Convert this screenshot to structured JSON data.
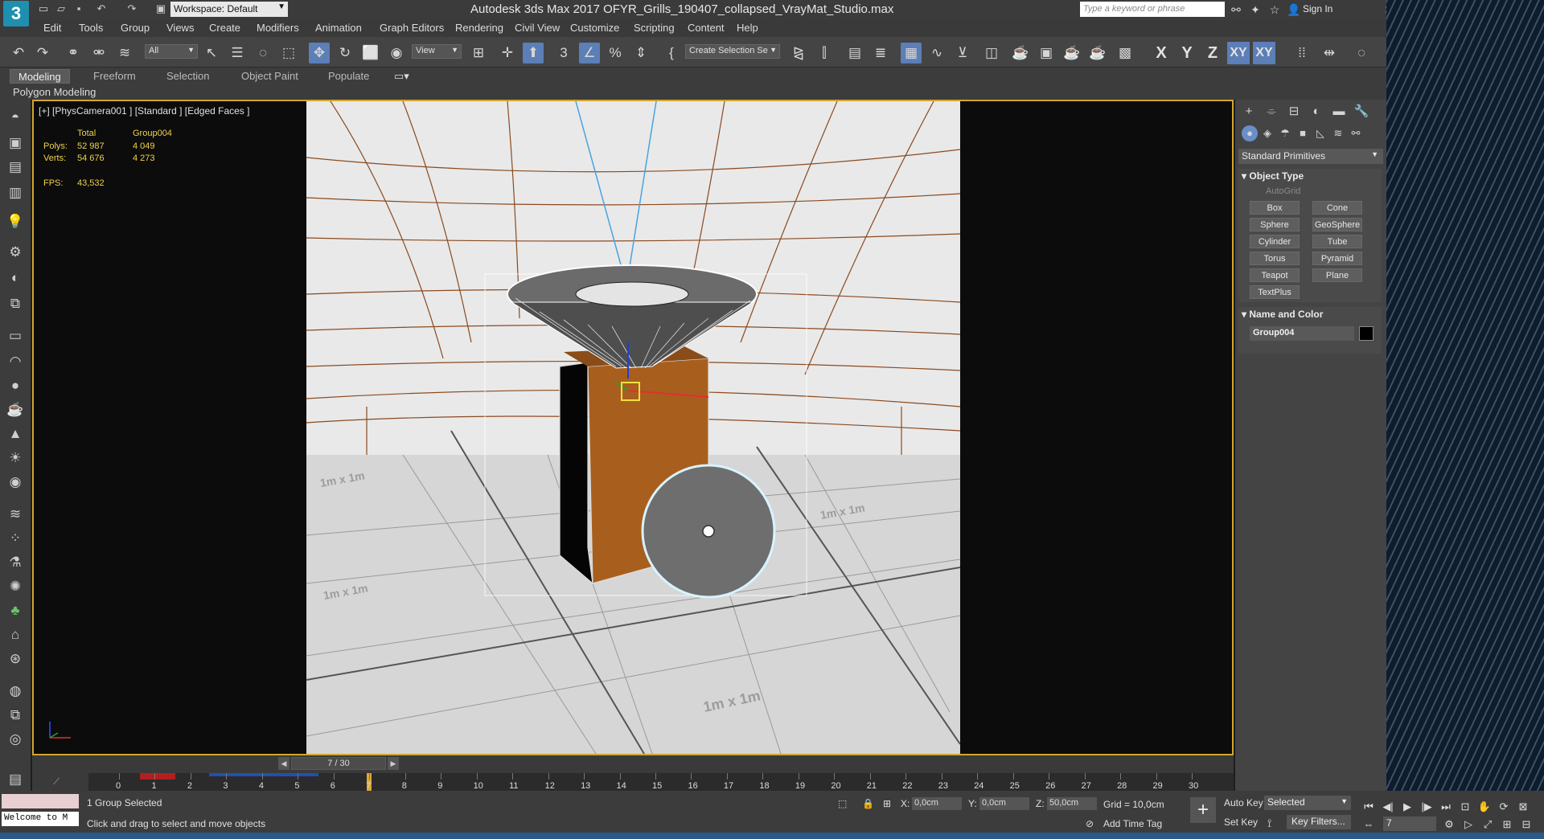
{
  "title": "Autodesk 3ds Max 2017    OFYR_Grills_190407_collapsed_VrayMat_Studio.max",
  "app_logo": "3",
  "workspace": "Workspace: Default",
  "search_placeholder": "Type a keyword or phrase",
  "sign_in": "Sign In",
  "menu": [
    "Edit",
    "Tools",
    "Group",
    "Views",
    "Create",
    "Modifiers",
    "Animation",
    "Graph Editors",
    "Rendering",
    "Civil View",
    "Customize",
    "Scripting",
    "Content",
    "Help"
  ],
  "toolbar": {
    "selection_filter": "All",
    "ref_coord": "View",
    "named_selection": "Create Selection Se",
    "axis_x": "X",
    "axis_y": "Y",
    "axis_z": "Z",
    "axis_xy": "XY",
    "axis_xy2": "XY"
  },
  "ribbon_tabs": [
    "Modeling",
    "Freeform",
    "Selection",
    "Object Paint",
    "Populate"
  ],
  "ribbon_panel": "Polygon Modeling",
  "viewport": {
    "label": "[+] [PhysCamera001 ] [Standard ] [Edged Faces ]",
    "stats_header_total": "Total",
    "stats_header_group": "Group004",
    "polys_label": "Polys:",
    "polys_total": "52 987",
    "polys_group": "4 049",
    "verts_label": "Verts:",
    "verts_total": "54 676",
    "verts_group": "4 273",
    "fps_label": "FPS:",
    "fps_value": "43,532",
    "grid_label": "1m x 1m"
  },
  "command_panel": {
    "category": "Standard Primitives",
    "object_type_header": "Object Type",
    "autogrid": "AutoGrid",
    "primitives": [
      "Box",
      "Cone",
      "Sphere",
      "GeoSphere",
      "Cylinder",
      "Tube",
      "Torus",
      "Pyramid",
      "Teapot",
      "Plane",
      "TextPlus"
    ],
    "name_color_header": "Name and Color",
    "object_name": "Group004",
    "object_color": "#000000"
  },
  "timeline": {
    "frame_display": "7 / 30",
    "ticks": [
      "0",
      "1",
      "2",
      "3",
      "4",
      "5",
      "6",
      "7",
      "8",
      "9",
      "10",
      "11",
      "12",
      "13",
      "14",
      "15",
      "16",
      "17",
      "18",
      "19",
      "20",
      "21",
      "22",
      "23",
      "24",
      "25",
      "26",
      "27",
      "28",
      "29",
      "30"
    ],
    "current_frame": 7
  },
  "status": {
    "welcome": "Welcome to M",
    "selection_msg": "1 Group Selected",
    "prompt_msg": "Click and drag to select and move objects",
    "x_label": "X:",
    "x_value": "0,0cm",
    "y_label": "Y:",
    "y_value": "0,0cm",
    "z_label": "Z:",
    "z_value": "50,0cm",
    "grid": "Grid = 10,0cm",
    "add_time_tag": "Add Time Tag",
    "auto_key": "Auto Key",
    "set_key": "Set Key",
    "key_mode": "Selected",
    "key_filters": "Key Filters...",
    "frame_field": "7"
  }
}
